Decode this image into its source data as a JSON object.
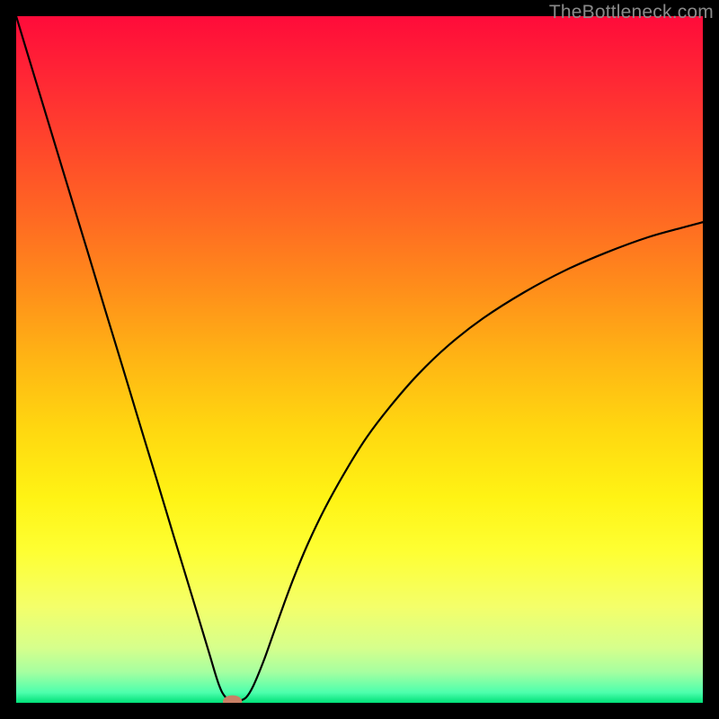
{
  "watermark": "TheBottleneck.com",
  "chart_data": {
    "type": "line",
    "title": "",
    "xlabel": "",
    "ylabel": "",
    "xlim": [
      0,
      100
    ],
    "ylim": [
      0,
      100
    ],
    "grid": false,
    "background_gradient": {
      "stops": [
        {
          "offset": 0.0,
          "color": "#ff0b3a"
        },
        {
          "offset": 0.1,
          "color": "#ff2a34"
        },
        {
          "offset": 0.2,
          "color": "#ff4a2a"
        },
        {
          "offset": 0.3,
          "color": "#ff6b22"
        },
        {
          "offset": 0.4,
          "color": "#ff8f1a"
        },
        {
          "offset": 0.5,
          "color": "#ffb514"
        },
        {
          "offset": 0.6,
          "color": "#ffd710"
        },
        {
          "offset": 0.7,
          "color": "#fff314"
        },
        {
          "offset": 0.78,
          "color": "#feff33"
        },
        {
          "offset": 0.86,
          "color": "#f4ff6a"
        },
        {
          "offset": 0.92,
          "color": "#d6ff8c"
        },
        {
          "offset": 0.955,
          "color": "#a6ffa0"
        },
        {
          "offset": 0.985,
          "color": "#4dffad"
        },
        {
          "offset": 1.0,
          "color": "#00e078"
        }
      ]
    },
    "series": [
      {
        "name": "curve",
        "stroke": "#000000",
        "x": [
          0.0,
          2.0,
          4.0,
          6.0,
          8.0,
          10.5,
          13.0,
          15.5,
          18.0,
          20.5,
          23.0,
          25.5,
          28.0,
          29.5,
          30.5,
          31.5,
          32.5,
          33.5,
          34.5,
          36.0,
          37.5,
          39.0,
          40.5,
          42.5,
          45.0,
          48.0,
          51.0,
          54.5,
          58.5,
          63.0,
          68.0,
          74.0,
          80.0,
          86.0,
          92.0,
          97.0,
          100.0
        ],
        "y": [
          100.0,
          93.4,
          86.8,
          80.2,
          73.6,
          65.4,
          57.1,
          48.9,
          40.6,
          32.4,
          24.1,
          15.9,
          7.6,
          2.7,
          0.8,
          0.3,
          0.3,
          0.8,
          2.4,
          6.0,
          10.2,
          14.4,
          18.4,
          23.2,
          28.4,
          33.8,
          38.6,
          43.2,
          47.8,
          52.1,
          56.0,
          59.8,
          63.0,
          65.6,
          67.8,
          69.2,
          70.0
        ]
      }
    ],
    "marker": {
      "x": 31.5,
      "y": 0.2,
      "rx": 1.4,
      "ry": 0.9,
      "color": "#c98066"
    }
  }
}
